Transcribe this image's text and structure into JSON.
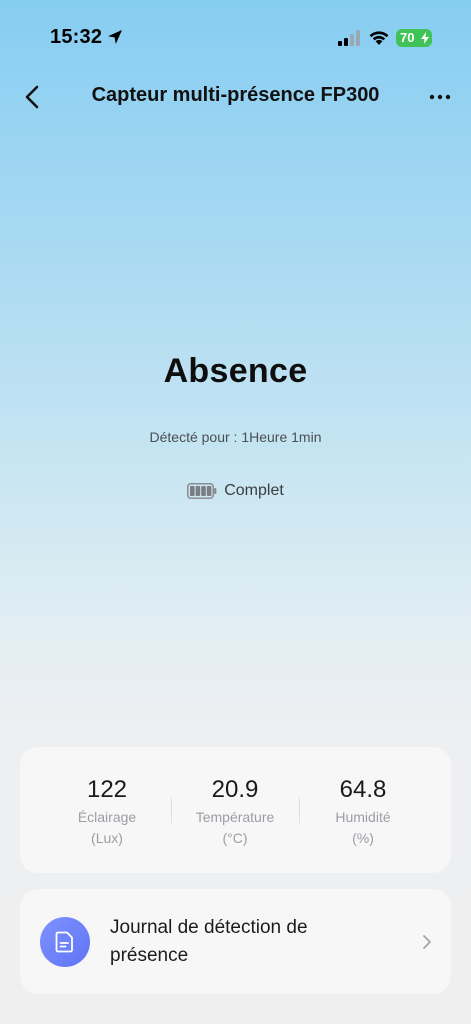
{
  "status_bar": {
    "time": "15:32",
    "battery_percent": "70",
    "icons": [
      "location-arrow-icon",
      "cellular-signal-icon",
      "wifi-icon",
      "charging-bolt-icon"
    ]
  },
  "nav": {
    "title": "Capteur multi-présence FP300",
    "back_icon": "chevron-left-icon",
    "more_icon": "more-horizontal-icon"
  },
  "presence": {
    "status": "Absence",
    "duration": "Détecté pour : 1Heure 1min",
    "battery_label": "Complet",
    "battery_icon": "battery-full-icon",
    "battery_level": 1.0
  },
  "sensors": [
    {
      "value": "122",
      "label_line1": "Éclairage",
      "label_line2": "(Lux)"
    },
    {
      "value": "20.9",
      "label_line1": "Température",
      "label_line2": "(°C)"
    },
    {
      "value": "64.8",
      "label_line1": "Humidité",
      "label_line2": "(%)"
    }
  ],
  "journal": {
    "label_line1": "Journal de détection de",
    "label_line2": "présence",
    "icon": "document-icon",
    "chevron_icon": "chevron-right-icon"
  },
  "colors": {
    "background_top": "#86cdf2",
    "background_bottom": "#efefef",
    "battery_green": "#3fc356",
    "journal_icon_accent": "#6b7ffa",
    "card_background": "#f7f7f7"
  }
}
